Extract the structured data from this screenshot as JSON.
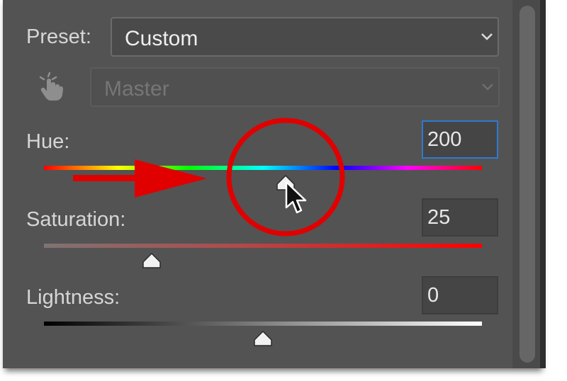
{
  "preset": {
    "label": "Preset:",
    "value": "Custom",
    "icon": "chevron-down-icon"
  },
  "channel": {
    "value": "Master",
    "disabled": true,
    "icon": "targeted-adjustment-hand-icon"
  },
  "hue": {
    "label": "Hue:",
    "value": "200",
    "focused": true,
    "slider_fraction": 0.55
  },
  "saturation": {
    "label": "Saturation:",
    "value": "25",
    "slider_fraction": 0.25
  },
  "lightness": {
    "label": "Lightness:",
    "value": "0",
    "slider_fraction": 0.5
  },
  "colors": {
    "panel_bg": "#535353",
    "annotation_red": "#e00000",
    "focus_blue": "#2f7ad0"
  }
}
